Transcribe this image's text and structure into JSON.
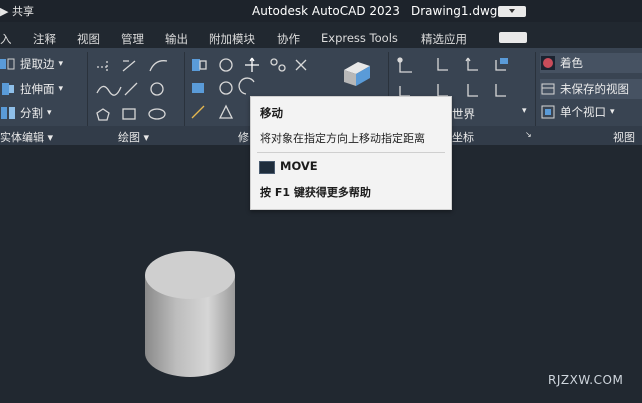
{
  "titlebar": {
    "share": "共享",
    "app_title": "Autodesk AutoCAD 2023",
    "document": "Drawing1.dwg"
  },
  "menu": [
    "入",
    "注释",
    "视图",
    "管理",
    "输出",
    "附加模块",
    "协作",
    "Express Tools",
    "精选应用"
  ],
  "ribbon": {
    "solid_edit": {
      "title": "实体编辑 ▾",
      "tools": [
        "提取边",
        "拉伸面",
        "分割"
      ]
    },
    "draw": {
      "title": "绘图 ▾"
    },
    "modify": {
      "title": "修"
    },
    "coordinates": {
      "title": "坐标",
      "ucs_value": "世界"
    },
    "view": {
      "title": "视图",
      "tools": [
        "着色",
        "未保存的视图",
        "单个视口"
      ]
    }
  },
  "tooltip": {
    "title": "移动",
    "description": "将对象在指定方向上移动指定距离",
    "command": "MOVE",
    "help": "按 F1 键获得更多帮助"
  },
  "watermark": "RJZXW.COM",
  "colors": {
    "background": "#212830",
    "ribbon": "#394452",
    "tooltip_bg": "#f3f3f3"
  }
}
